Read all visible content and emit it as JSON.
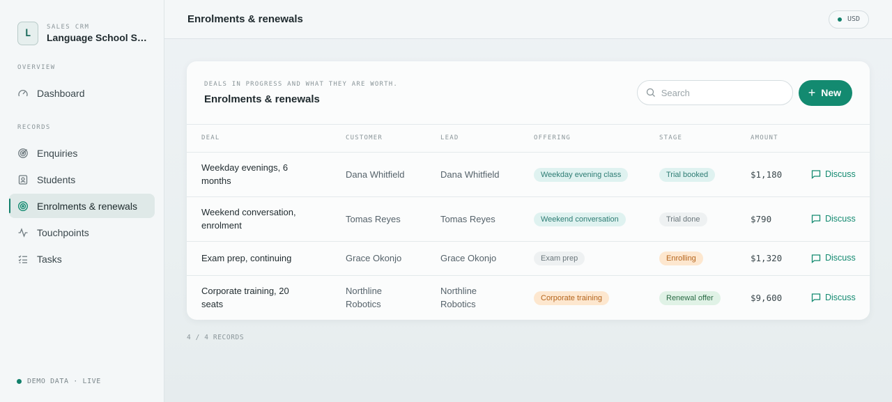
{
  "brand": {
    "kicker": "SALES CRM",
    "name": "Language School Sal…",
    "logo_letter": "L"
  },
  "sidebar": {
    "sections": [
      {
        "label": "OVERVIEW",
        "items": [
          {
            "label": "Dashboard",
            "icon": "gauge-icon"
          }
        ]
      },
      {
        "label": "RECORDS",
        "items": [
          {
            "label": "Enquiries",
            "icon": "target-icon"
          },
          {
            "label": "Students",
            "icon": "contact-card-icon"
          },
          {
            "label": "Enrolments & renewals",
            "icon": "bullseye-icon",
            "active": true
          },
          {
            "label": "Touchpoints",
            "icon": "activity-icon"
          },
          {
            "label": "Tasks",
            "icon": "checklist-icon"
          }
        ]
      }
    ],
    "footer": "DEMO DATA · LIVE"
  },
  "topbar": {
    "title": "Enrolments & renewals",
    "currency": "USD"
  },
  "card": {
    "kicker": "DEALS IN PROGRESS AND WHAT THEY ARE WORTH.",
    "title": "Enrolments & renewals",
    "search_placeholder": "Search",
    "new_label": "New"
  },
  "table": {
    "columns": [
      "DEAL",
      "CUSTOMER",
      "LEAD",
      "OFFERING",
      "STAGE",
      "AMOUNT"
    ],
    "rows": [
      {
        "deal": "Weekday evenings, 6 months",
        "customer": "Dana Whitfield",
        "lead": "Dana Whitfield",
        "offering": "Weekday evening class",
        "offering_tone": "teal",
        "stage": "Trial booked",
        "stage_tone": "teal",
        "amount": "$1,180",
        "action": "Discuss"
      },
      {
        "deal": "Weekend conversation, enrolment",
        "customer": "Tomas Reyes",
        "lead": "Tomas Reyes",
        "offering": "Weekend conversation",
        "offering_tone": "teal",
        "stage": "Trial done",
        "stage_tone": "grey",
        "amount": "$790",
        "action": "Discuss"
      },
      {
        "deal": "Exam prep, continuing",
        "customer": "Grace Okonjo",
        "lead": "Grace Okonjo",
        "offering": "Exam prep",
        "offering_tone": "grey",
        "stage": "Enrolling",
        "stage_tone": "orange",
        "amount": "$1,320",
        "action": "Discuss"
      },
      {
        "deal": "Corporate training, 20 seats",
        "customer": "Northline Robotics",
        "lead": "Northline Robotics",
        "offering": "Corporate training",
        "offering_tone": "orange",
        "stage": "Renewal offer",
        "stage_tone": "green",
        "amount": "$9,600",
        "action": "Discuss"
      }
    ]
  },
  "records_count": "4 / 4 RECORDS",
  "colors": {
    "accent": "#138a70",
    "sidebar_bg": "#f4f7f8",
    "active_bg": "#dfe9e8"
  }
}
